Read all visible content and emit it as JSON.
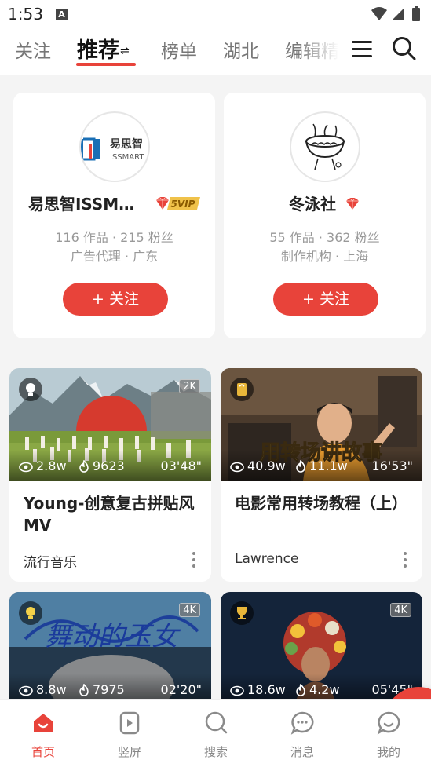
{
  "status_bar": {
    "time": "1:53",
    "notification_letter": "A"
  },
  "top_nav": {
    "tabs": [
      {
        "label": "关注",
        "active": false
      },
      {
        "label": "推荐",
        "active": true,
        "sort_glyph": "⇌"
      },
      {
        "label": "榜单",
        "active": false
      },
      {
        "label": "湖北",
        "active": false
      },
      {
        "label": "编辑精",
        "active": false
      }
    ],
    "menu_icon": "hamburger-menu-icon",
    "search_icon": "search-icon"
  },
  "creators": [
    {
      "name": "易思智ISSMA...",
      "avatar_text_cn": "易思智",
      "avatar_text_en": "ISSMART",
      "badge": "5VIP",
      "stats": "116 作品 · 215 粉丝",
      "meta": "广告代理 · 广东",
      "follow_label": "+ 关注"
    },
    {
      "name": "冬泳社",
      "stats": "55 作品 · 362 粉丝",
      "meta": "制作机构 · 上海",
      "follow_label": "+ 关注"
    }
  ],
  "videos": [
    {
      "title": "Young-创意复古拼贴风MV",
      "author": "流行音乐",
      "views": "2.8w",
      "likes": "9623",
      "duration": "03'48\"",
      "resolution": "2K"
    },
    {
      "title": "电影常用转场教程（上）",
      "author": "Lawrence",
      "views": "40.9w",
      "likes": "11.1w",
      "duration": "16'53\"",
      "resolution": "",
      "overlay_text": "用转场讲故事"
    },
    {
      "title": "",
      "author": "",
      "views": "8.8w",
      "likes": "7975",
      "duration": "02'20\"",
      "resolution": "4K",
      "overlay_text": "舞动的玉女"
    },
    {
      "title": "",
      "author": "",
      "views": "18.6w",
      "likes": "4.2w",
      "duration": "05'45\"",
      "resolution": "4K"
    }
  ],
  "bottom_nav": [
    {
      "label": "首页",
      "icon": "home-icon",
      "active": true
    },
    {
      "label": "竖屏",
      "icon": "vertical-video-icon",
      "active": false
    },
    {
      "label": "搜索",
      "icon": "search-icon",
      "active": false
    },
    {
      "label": "消息",
      "icon": "message-icon",
      "active": false
    },
    {
      "label": "我的",
      "icon": "profile-icon",
      "active": false
    }
  ],
  "fab": {
    "icon": "plus-icon"
  },
  "colors": {
    "accent": "#e8433a",
    "background": "#f4f4f4"
  }
}
